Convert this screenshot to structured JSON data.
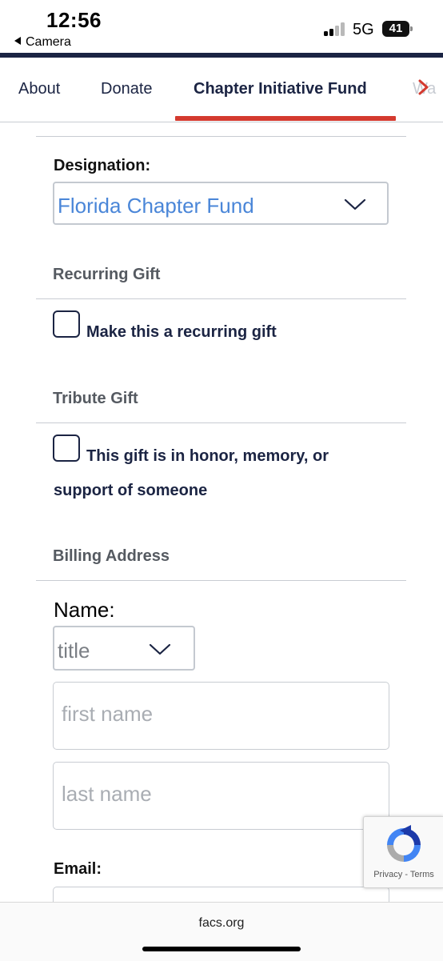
{
  "status_bar": {
    "time": "12:56",
    "back_app": "Camera",
    "network": "5G",
    "battery": "41"
  },
  "tabs": [
    {
      "label": "About"
    },
    {
      "label": "Donate"
    },
    {
      "label": "Chapter Initiative Fund",
      "active": true
    },
    {
      "label": "Wa"
    }
  ],
  "designation": {
    "label": "Designation:",
    "selected": "Florida Chapter Fund"
  },
  "recurring": {
    "title": "Recurring Gift",
    "checkbox_label": "Make this a recurring gift"
  },
  "tribute": {
    "title": "Tribute Gift",
    "checkbox_label_line1": "This gift is in honor, memory, or",
    "checkbox_label_line2": "support of someone"
  },
  "billing": {
    "title": "Billing Address",
    "name_label": "Name:",
    "title_select": "title",
    "first_name_placeholder": "first name",
    "last_name_placeholder": "last name",
    "email_label": "Email:"
  },
  "recaptcha": {
    "privacy": "Privacy",
    "separator": " - ",
    "terms": "Terms"
  },
  "browser": {
    "url": "facs.org"
  },
  "colors": {
    "navy": "#1b2443",
    "accent_red": "#d43a2f",
    "link_blue": "#4a86d8"
  }
}
